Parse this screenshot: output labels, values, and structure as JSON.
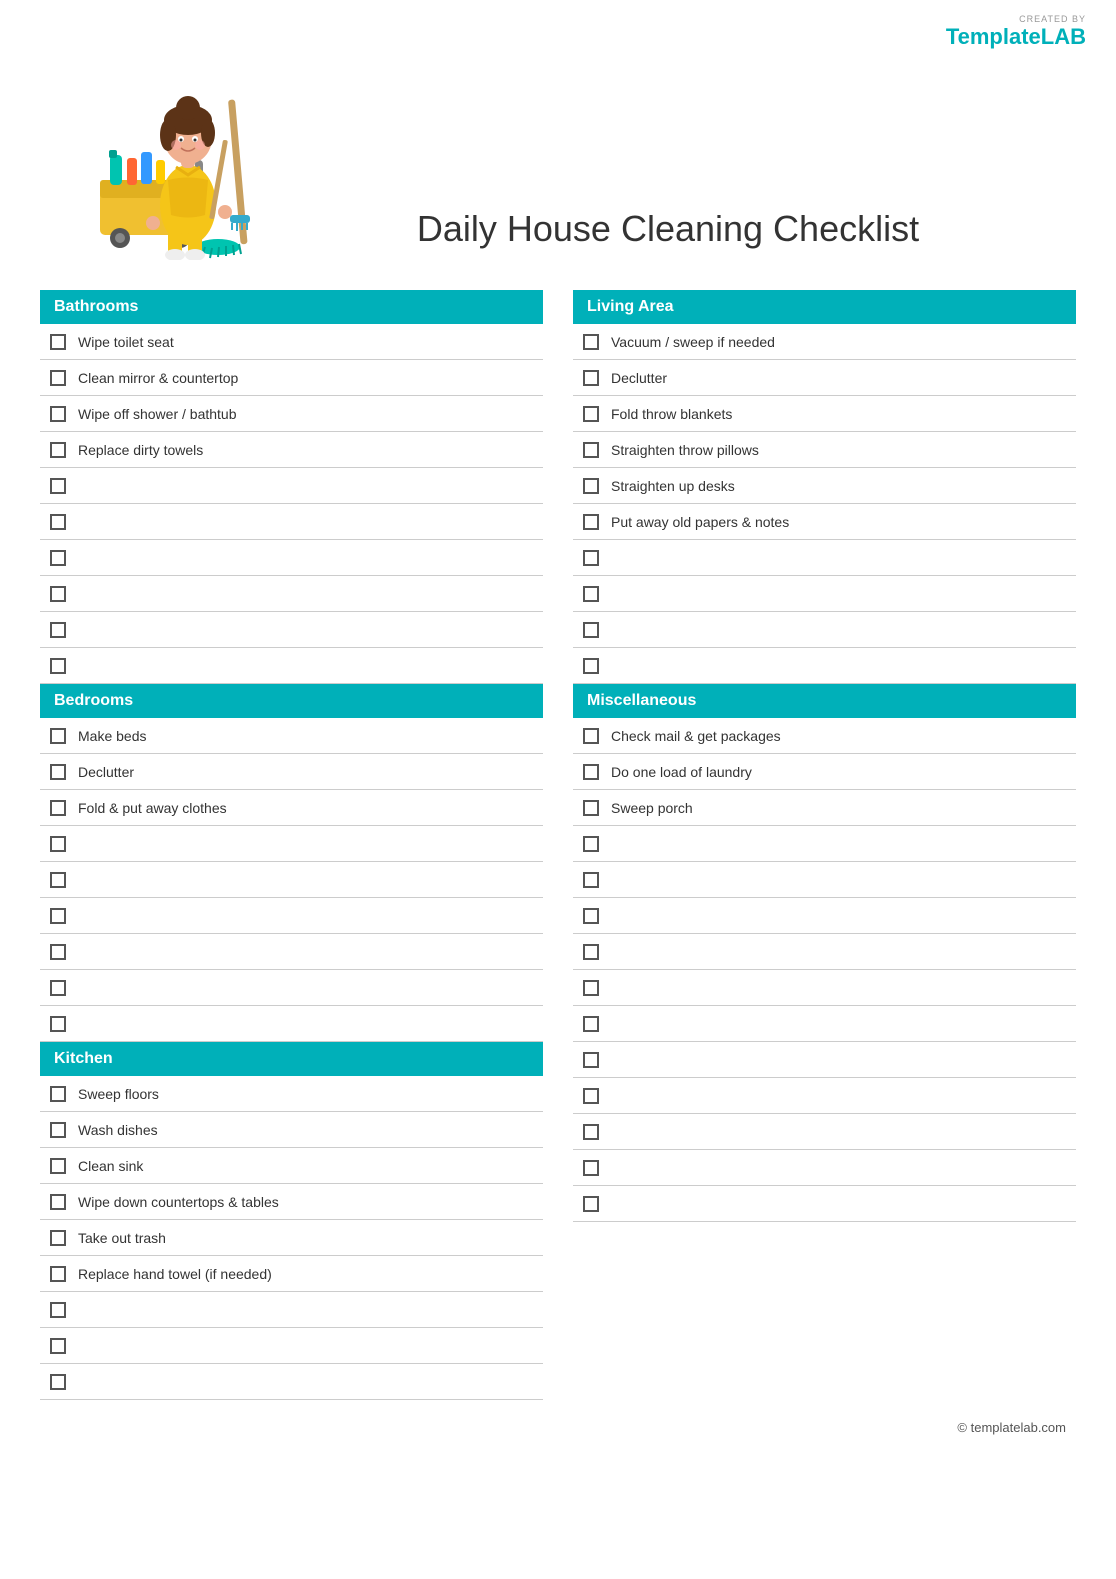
{
  "logo": {
    "created_by": "CREATED BY",
    "brand_template": "Template",
    "brand_lab": "LAB"
  },
  "page_title": "Daily House Cleaning Checklist",
  "sections": {
    "left": [
      {
        "id": "bathrooms",
        "header": "Bathrooms",
        "items": [
          "Wipe toilet seat",
          "Clean mirror & countertop",
          "Wipe off shower / bathtub",
          "Replace dirty towels",
          "",
          "",
          "",
          "",
          "",
          ""
        ]
      },
      {
        "id": "bedrooms",
        "header": "Bedrooms",
        "items": [
          "Make beds",
          "Declutter",
          "Fold & put away clothes",
          "",
          "",
          "",
          "",
          "",
          ""
        ]
      },
      {
        "id": "kitchen",
        "header": "Kitchen",
        "items": [
          "Sweep floors",
          "Wash dishes",
          "Clean sink",
          "Wipe down countertops & tables",
          "Take out trash",
          "Replace hand towel (if needed)",
          "",
          "",
          ""
        ]
      }
    ],
    "right": [
      {
        "id": "living-area",
        "header": "Living Area",
        "items": [
          "Vacuum / sweep if needed",
          "Declutter",
          "Fold throw blankets",
          "Straighten throw pillows",
          "Straighten up desks",
          "Put away old papers & notes",
          "",
          "",
          "",
          ""
        ]
      },
      {
        "id": "miscellaneous",
        "header": "Miscellaneous",
        "items": [
          "Check mail & get packages",
          "Do one load of laundry",
          "Sweep porch",
          "",
          "",
          "",
          "",
          "",
          "",
          "",
          "",
          "",
          "",
          ""
        ]
      }
    ]
  },
  "footer": {
    "copyright": "© templatelab.com"
  }
}
